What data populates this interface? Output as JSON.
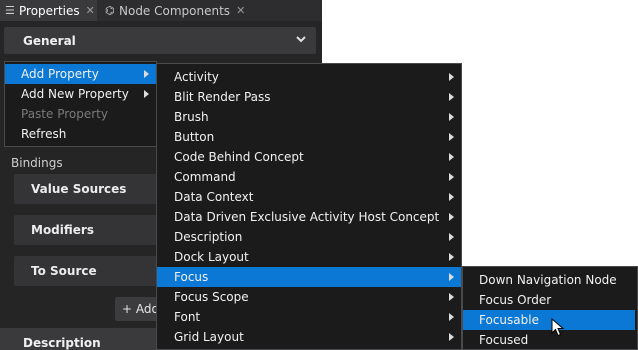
{
  "tabs": [
    {
      "label": "Properties",
      "icon": "list-icon",
      "close": "✕"
    },
    {
      "label": "Node Components",
      "icon": "components-icon",
      "close": "✕"
    }
  ],
  "general": {
    "title": "General"
  },
  "bindings": {
    "label": "Bindings",
    "sections": [
      "Value Sources",
      "Modifiers",
      "To Source"
    ],
    "add_button": "+ Add"
  },
  "description": {
    "title": "Description"
  },
  "context_menu": [
    {
      "label": "Add Property",
      "submenu": true,
      "selected": true,
      "disabled": false
    },
    {
      "label": "Add New Property",
      "submenu": true,
      "selected": false,
      "disabled": false
    },
    {
      "label": "Paste Property",
      "submenu": false,
      "selected": false,
      "disabled": true
    },
    {
      "label": "Refresh",
      "submenu": false,
      "selected": false,
      "disabled": false
    }
  ],
  "property_menu": [
    {
      "label": "Activity",
      "selected": false
    },
    {
      "label": "Blit Render Pass",
      "selected": false
    },
    {
      "label": "Brush",
      "selected": false
    },
    {
      "label": "Button",
      "selected": false
    },
    {
      "label": "Code Behind Concept",
      "selected": false
    },
    {
      "label": "Command",
      "selected": false
    },
    {
      "label": "Data Context",
      "selected": false
    },
    {
      "label": "Data Driven Exclusive Activity Host Concept",
      "selected": false
    },
    {
      "label": "Description",
      "selected": false
    },
    {
      "label": "Dock Layout",
      "selected": false
    },
    {
      "label": "Focus",
      "selected": true
    },
    {
      "label": "Focus Scope",
      "selected": false
    },
    {
      "label": "Font",
      "selected": false
    },
    {
      "label": "Grid Layout",
      "selected": false
    }
  ],
  "focus_menu": [
    {
      "label": "Down Navigation Node",
      "selected": false
    },
    {
      "label": "Focus Order",
      "selected": false
    },
    {
      "label": "Focusable",
      "selected": true
    },
    {
      "label": "Focused",
      "selected": false
    }
  ],
  "colors": {
    "highlight": "#0a78d4",
    "menu_bg": "#1b1b1c",
    "panel_bg": "#252526"
  }
}
